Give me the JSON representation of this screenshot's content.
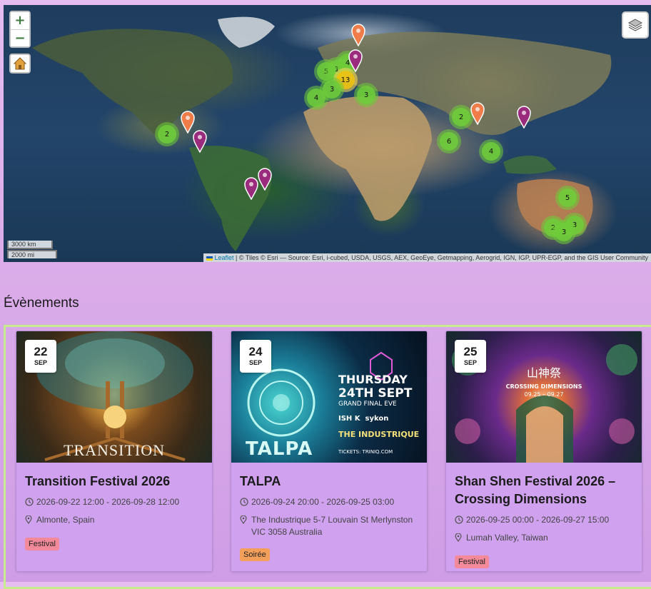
{
  "map": {
    "zoom_in": "+",
    "zoom_out": "−",
    "scale_km": "3000 km",
    "scale_mi": "2000 mi",
    "attribution_leaflet": "Leaflet",
    "attribution_text": " | © Tiles © Esri — Source: Esri, i-cubed, USDA, USGS, AEX, GeoEye, Getmapping, Aerogrid, IGN, IGP, UPR-EGP, and the GIS User Community",
    "clusters": [
      {
        "label": "5",
        "color": "green"
      },
      {
        "label": "1",
        "color": "green"
      },
      {
        "label": "4",
        "color": "green"
      },
      {
        "label": "13",
        "color": "yellow"
      },
      {
        "label": "3",
        "color": "green"
      },
      {
        "label": "4",
        "color": "green"
      },
      {
        "label": "3",
        "color": "green"
      },
      {
        "label": "2",
        "color": "green"
      },
      {
        "label": "2",
        "color": "green"
      },
      {
        "label": "6",
        "color": "green"
      },
      {
        "label": "4",
        "color": "green"
      },
      {
        "label": "5",
        "color": "green"
      },
      {
        "label": "2",
        "color": "green"
      },
      {
        "label": "3",
        "color": "green"
      },
      {
        "label": "3",
        "color": "green"
      }
    ],
    "pin_colors": {
      "orange": "#f07c4a",
      "purple": "#9b2c7d"
    }
  },
  "events": {
    "heading": "Évènements",
    "cards": [
      {
        "day": "22",
        "month": "SEP",
        "title": "Transition Festival 2026",
        "dates": "2026-09-22 12:00 - 2026-09-28 12:00",
        "location": "Almonte, Spain",
        "tag": "Festival",
        "tag_color": "#f4899a",
        "poster_text": "TRANSITION"
      },
      {
        "day": "24",
        "month": "SEP",
        "title": "TALPA",
        "dates": "2026-09-24 20:00 - 2026-09-25 03:00",
        "location": "The Industrique 5-7 Louvain St Merlynston VIC 3058 Australia",
        "tag": "Soirée",
        "tag_color": "#f5a05a",
        "poster_text": "TALPA",
        "poster_lines": [
          "THURSDAY",
          "24TH SEPT",
          "GRAND FINAL EVE",
          "THE INDUSTRIQUE",
          "TICKETS: TRINIQ.COM",
          "ISH K",
          "sykon"
        ]
      },
      {
        "day": "25",
        "month": "SEP",
        "title": "Shan Shen Festival 2026 – Crossing Dimensions",
        "dates": "2026-09-25 00:00 - 2026-09-27 15:00",
        "location": "Lumah Valley, Taiwan",
        "tag": "Festival",
        "tag_color": "#f4899a",
        "poster_text": "山神祭",
        "poster_lines": [
          "CROSSING DIMENSIONS",
          "09.25 – 09.27"
        ]
      }
    ]
  }
}
